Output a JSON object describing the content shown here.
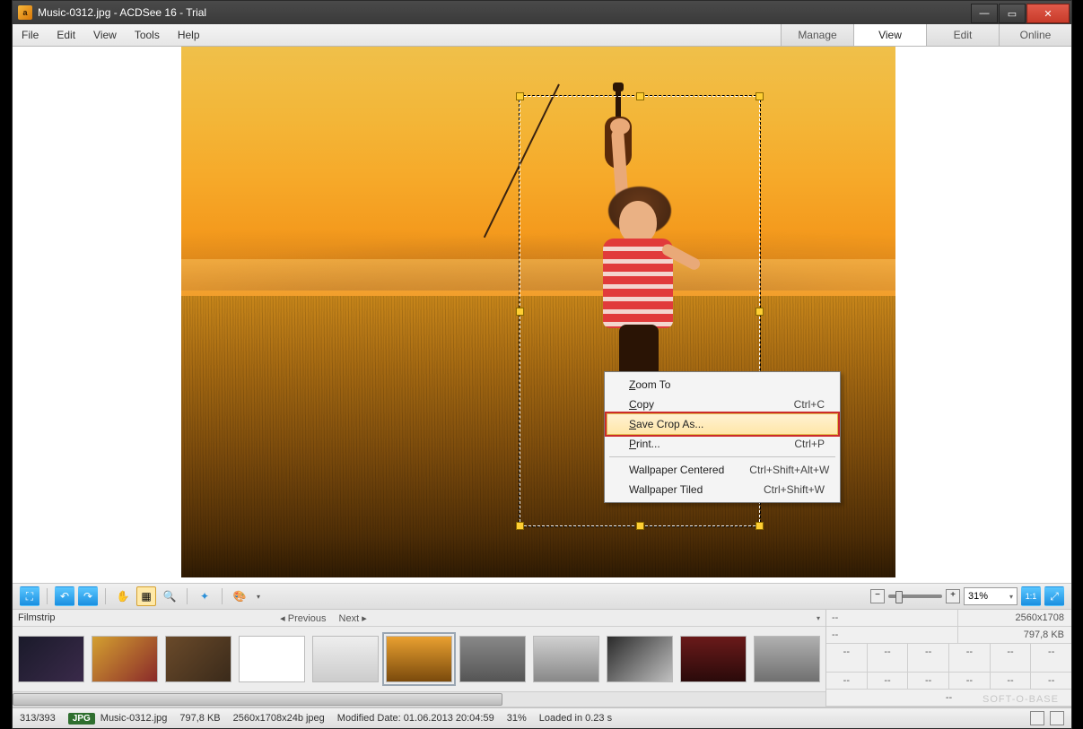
{
  "titlebar": {
    "title": "Music-0312.jpg - ACDSee 16 - Trial"
  },
  "menubar": {
    "items": [
      "File",
      "Edit",
      "View",
      "Tools",
      "Help"
    ]
  },
  "modes": {
    "tabs": [
      "Manage",
      "View",
      "Edit",
      "Online"
    ],
    "active": "View"
  },
  "context_menu": {
    "items": [
      {
        "label": "Zoom To",
        "u": "Z",
        "shortcut": ""
      },
      {
        "label": "Copy",
        "u": "C",
        "shortcut": "Ctrl+C"
      },
      {
        "label": "Save Crop As...",
        "u": "S",
        "shortcut": "",
        "hl": true
      },
      {
        "label": "Print...",
        "u": "P",
        "shortcut": "Ctrl+P"
      },
      {
        "sep": true
      },
      {
        "label": "Wallpaper Centered",
        "shortcut": "Ctrl+Shift+Alt+W"
      },
      {
        "label": "Wallpaper Tiled",
        "shortcut": "Ctrl+Shift+W"
      }
    ]
  },
  "zoom": {
    "value": "31%"
  },
  "filmstrip": {
    "title": "Filmstrip",
    "prev": "Previous",
    "next": "Next"
  },
  "info": {
    "top_left": "--",
    "dimensions": "2560x1708",
    "size": "797,8 KB",
    "dash": "--"
  },
  "status": {
    "counter": "313/393",
    "badge": "JPG",
    "filename": "Music-0312.jpg",
    "filesize": "797,8 KB",
    "dims": "2560x1708x24b jpeg",
    "modified": "Modified Date: 01.06.2013 20:04:59",
    "zoom": "31%",
    "loaded": "Loaded in 0.23 s"
  },
  "watermark": "SOFT-O-BASE"
}
